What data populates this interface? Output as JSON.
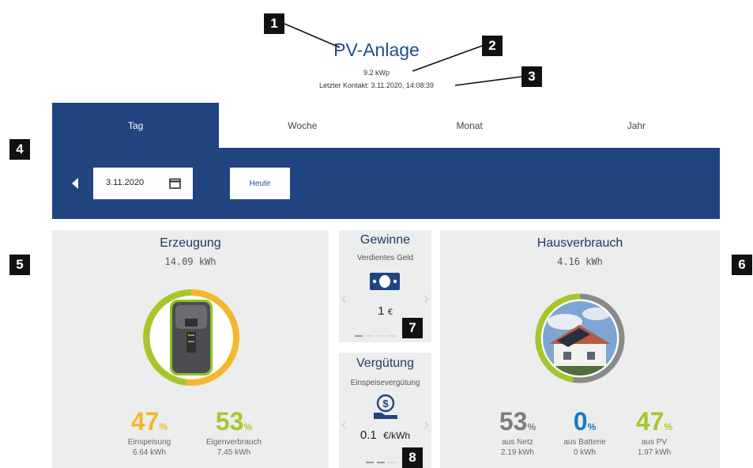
{
  "header": {
    "title": "PV-Anlage",
    "power": "9.2 kWp",
    "last_contact": "Letzter Kontakt: 3.11.2020, 14:08:39"
  },
  "tabs": [
    {
      "label": "Tag",
      "active": true
    },
    {
      "label": "Woche",
      "active": false
    },
    {
      "label": "Monat",
      "active": false
    },
    {
      "label": "Jahr",
      "active": false
    }
  ],
  "date_bar": {
    "date_value": "3.11.2020",
    "today_label": "Heute",
    "prev_icon": "triangle-left-icon",
    "calendar_icon": "calendar-icon"
  },
  "production": {
    "title": "Erzeugung",
    "total": "14.09 kWh",
    "feed_in_pct": "47",
    "feed_in_label": "Einspeisung",
    "feed_in_kwh": "6.64 kWh",
    "self_pct": "53",
    "self_label": "Eigenverbrauch",
    "self_kwh": "7.45 kWh",
    "pct_unit": "%"
  },
  "earnings": {
    "title": "Gewinne",
    "subtitle": "Verdientes Geld",
    "value": "1",
    "unit": "€",
    "icon": "banknote-icon"
  },
  "compensation": {
    "title": "Vergütung",
    "subtitle": "Einspeisevergütung",
    "value": "0.1",
    "unit": "€/kWh",
    "icon": "coin-hand-icon"
  },
  "house": {
    "title": "Hausverbrauch",
    "total": "4.16 kWh",
    "grid_pct": "53",
    "grid_label": "aus Netz",
    "grid_kwh": "2.19 kWh",
    "battery_pct": "0",
    "battery_label": "aus Batterie",
    "battery_kwh": "0 kWh",
    "pv_pct": "47",
    "pv_label": "aus PV",
    "pv_kwh": "1.97 kWh",
    "pct_unit": "%"
  },
  "callouts": [
    "1",
    "2",
    "3",
    "4",
    "5",
    "6",
    "7",
    "8"
  ],
  "colors": {
    "navy": "#1f4480",
    "orange": "#f6b72c",
    "green": "#a8c62c",
    "grey": "#7d7d7d",
    "blue": "#1e77c5"
  }
}
